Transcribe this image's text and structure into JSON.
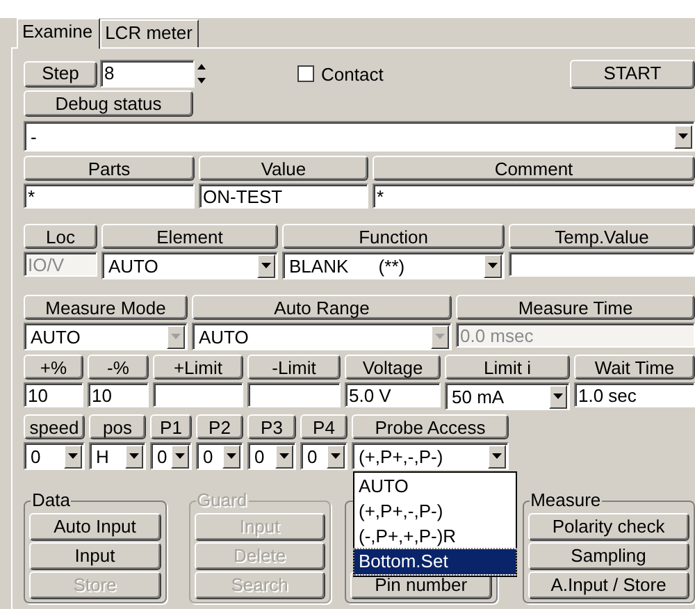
{
  "tabs": [
    {
      "label": "Examine",
      "selected": true
    },
    {
      "label": "LCR meter",
      "selected": false
    }
  ],
  "step": {
    "label": "Step",
    "value": "8"
  },
  "contact": {
    "label": "Contact",
    "checked": false
  },
  "start_button": "START",
  "debug_button": "Debug status",
  "debug_combo": {
    "value": "-"
  },
  "grid_rows": [
    {
      "headers": [
        "Parts",
        "Value",
        "Comment"
      ],
      "cells": [
        {
          "kind": "field",
          "value": "*",
          "disabled": false
        },
        {
          "kind": "field",
          "value": "ON-TEST",
          "disabled": false
        },
        {
          "kind": "field",
          "value": "*",
          "disabled": false
        }
      ]
    },
    {
      "headers": [
        "Loc",
        "Element",
        "Function",
        "Temp.Value"
      ],
      "cells": [
        {
          "kind": "field",
          "value": "IO/V",
          "disabled": true
        },
        {
          "kind": "combo",
          "value": "AUTO",
          "disabled": false
        },
        {
          "kind": "combo",
          "value": "BLANK      (**)",
          "disabled": false
        },
        {
          "kind": "field",
          "disabled": false
        }
      ]
    },
    {
      "headers": [
        "Measure Mode",
        "Auto Range",
        "Measure Time"
      ],
      "cells": [
        {
          "kind": "combo",
          "value": "AUTO",
          "disabled": true
        },
        {
          "kind": "combo",
          "value": "AUTO",
          "disabled": true
        },
        {
          "kind": "field",
          "value": "0.0 msec",
          "disabled": true
        }
      ]
    },
    {
      "headers": [
        "+%",
        "-%",
        "+Limit",
        "-Limit",
        "Voltage",
        "Limit i",
        "Wait Time"
      ],
      "cells": [
        {
          "kind": "field",
          "value": "10",
          "disabled": false
        },
        {
          "kind": "field",
          "value": "10",
          "disabled": false
        },
        {
          "kind": "field",
          "disabled": false
        },
        {
          "kind": "field",
          "disabled": false
        },
        {
          "kind": "field",
          "value": "5.0 V",
          "disabled": false
        },
        {
          "kind": "combo",
          "value": "50 mA",
          "disabled": false
        },
        {
          "kind": "field",
          "value": "1.0 sec",
          "disabled": false
        }
      ]
    },
    {
      "headers": [
        "speed",
        "pos",
        "P1",
        "P2",
        "P3",
        "P4",
        "Probe Access"
      ],
      "cells": [
        {
          "kind": "combo",
          "value": "0",
          "disabled": false
        },
        {
          "kind": "combo",
          "value": "H",
          "disabled": false
        },
        {
          "kind": "combo",
          "value": "0",
          "disabled": false
        },
        {
          "kind": "combo",
          "value": "0",
          "disabled": false
        },
        {
          "kind": "combo",
          "value": "0",
          "disabled": false
        },
        {
          "kind": "combo",
          "value": "0",
          "disabled": false
        },
        {
          "kind": "combo",
          "value": "(+,P+,-,P-)",
          "disabled": false
        }
      ]
    }
  ],
  "probe_dropdown": {
    "options": [
      {
        "label": "AUTO",
        "selected": false
      },
      {
        "label": "(+,P+,-,P-)",
        "selected": false
      },
      {
        "label": "(-,P+,+,P-)R",
        "selected": false
      },
      {
        "label": "Bottom.Set",
        "selected": true
      }
    ]
  },
  "groups": [
    {
      "legend": "Data",
      "disabled": false,
      "buttons": [
        {
          "label": "Auto Input",
          "disabled": false
        },
        {
          "label": "Input",
          "disabled": false
        },
        {
          "label": "Store",
          "disabled": true
        }
      ]
    },
    {
      "legend": "Guard",
      "disabled": true,
      "buttons": [
        {
          "label": "Input",
          "disabled": true
        },
        {
          "label": "Delete",
          "disabled": true
        },
        {
          "label": "Search",
          "disabled": true
        }
      ]
    },
    {
      "disabled": false,
      "buttons": [
        {
          "label": "Pin number",
          "disabled": false
        }
      ]
    },
    {
      "legend": "Measure",
      "disabled": false,
      "buttons": [
        {
          "label": "Polarity check",
          "disabled": false
        },
        {
          "label": "Sampling",
          "disabled": false
        },
        {
          "label": "A.Input / Store",
          "disabled": false
        }
      ]
    }
  ]
}
